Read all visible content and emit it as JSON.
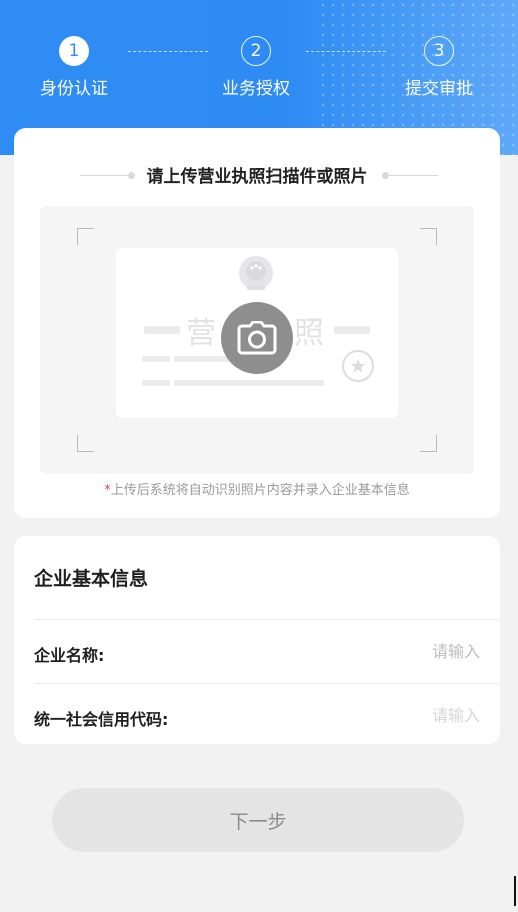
{
  "stepper": {
    "steps": [
      {
        "number": "1",
        "label": "身份认证",
        "active": true
      },
      {
        "number": "2",
        "label": "业务授权",
        "active": false
      },
      {
        "number": "3",
        "label": "提交审批",
        "active": false
      }
    ]
  },
  "upload": {
    "title": "请上传营业执照扫描件或照片",
    "illustration_left_char": "营",
    "illustration_right_char": "照",
    "hint_star": "*",
    "hint": "上传后系统将自动识别照片内容并录入企业基本信息"
  },
  "company_info": {
    "title": "企业基本信息",
    "fields": [
      {
        "label": "企业名称:",
        "placeholder": "请输入",
        "value": ""
      },
      {
        "label": "统一社会信用代码:",
        "placeholder": "请输入",
        "value": ""
      }
    ]
  },
  "next_button": {
    "label": "下一步"
  },
  "colors": {
    "primary": "#2e8cf5",
    "background": "#f2f2f2",
    "camera": "#8e8e8e",
    "button_disabled_bg": "#e4e4e4",
    "button_disabled_text": "#8a8a8a",
    "hint_star": "#e8463b"
  },
  "icons": {
    "camera": "camera-icon",
    "emblem": "national-emblem-icon",
    "stamp": "stamp-icon"
  }
}
